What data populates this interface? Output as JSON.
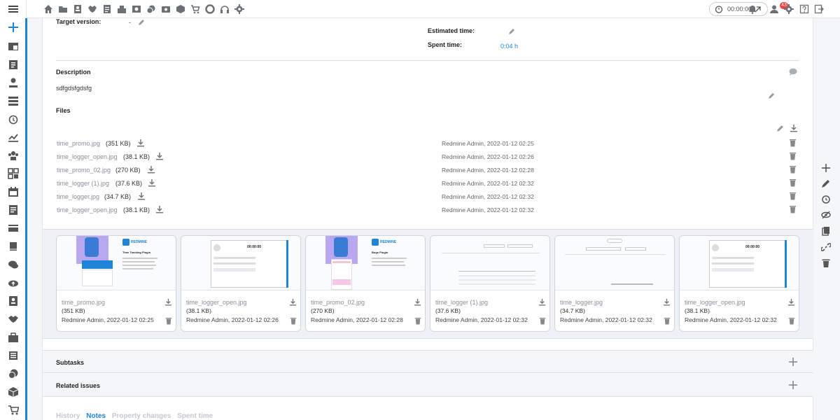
{
  "sidebar": {
    "icons": [
      "menu-icon",
      "plus-icon",
      "projects-icon",
      "clipboard-icon",
      "person-location-icon",
      "list-icon",
      "alarm-icon",
      "chart-icon",
      "group-icon",
      "grid-icon",
      "calendar-icon",
      "document-icon",
      "card-icon",
      "book-icon",
      "chat-icon",
      "cloud-upload-icon",
      "contact-icon",
      "handshake-icon",
      "briefcase-icon",
      "news-icon",
      "coins-icon",
      "box-icon",
      "cart-icon"
    ]
  },
  "topbar": {
    "icons": [
      "home-icon",
      "folder-icon",
      "contacts-icon",
      "handshake-icon",
      "invoice-icon",
      "inventory-icon",
      "money-icon",
      "coins-icon",
      "cash-icon",
      "box-icon",
      "cart-icon",
      "lifebuoy-icon",
      "headset-icon",
      "gear-icon"
    ],
    "timer": "00:00:00",
    "notifications_count": "43",
    "right_icons": [
      "user-icon",
      "admin-gear-icon",
      "help-icon",
      "logout-icon"
    ]
  },
  "issue": {
    "target_version_label": "Target version:",
    "target_version_value": "-",
    "estimated_time_label": "Estimated time:",
    "spent_time_label": "Spent time:",
    "spent_time_value": "0:04 h"
  },
  "description": {
    "title": "Description",
    "text": "sdfgdsfgdsfg"
  },
  "files": {
    "title": "Files",
    "items": [
      {
        "name": "time_promo.jpg",
        "size": "(351 KB)",
        "meta": "Redmine Admin, 2022-01-12 02:25"
      },
      {
        "name": "time_logger_open.jpg",
        "size": "(38.1 KB)",
        "meta": "Redmine Admin, 2022-01-12 02:26"
      },
      {
        "name": "time_promo_02.jpg",
        "size": "(270 KB)",
        "meta": "Redmine Admin, 2022-01-12 02:28"
      },
      {
        "name": "time_logger (1).jpg",
        "size": "(37.6 KB)",
        "meta": "Redmine Admin, 2022-01-12 02:32"
      },
      {
        "name": "time_logger.jpg",
        "size": "(34.7 KB)",
        "meta": "Redmine Admin, 2022-01-12 02:32"
      },
      {
        "name": "time_logger_open.jpg",
        "size": "(38.1 KB)",
        "meta": "Redmine Admin, 2022-01-12 02:32"
      }
    ]
  },
  "thumbnails": {
    "promo_brand": "REDMINE",
    "promo1_title": "Time Tracking Plugin",
    "promo2_title": "Bugs Plugin",
    "timer_text": "00:00:00"
  },
  "sections": {
    "subtasks": "Subtasks",
    "related_issues": "Related issues"
  },
  "tabs": [
    "History",
    "Notes",
    "Property changes",
    "Spent time"
  ],
  "active_tab": "Notes",
  "colors": {
    "accent": "#1f84d8",
    "badge": "#e44444"
  }
}
